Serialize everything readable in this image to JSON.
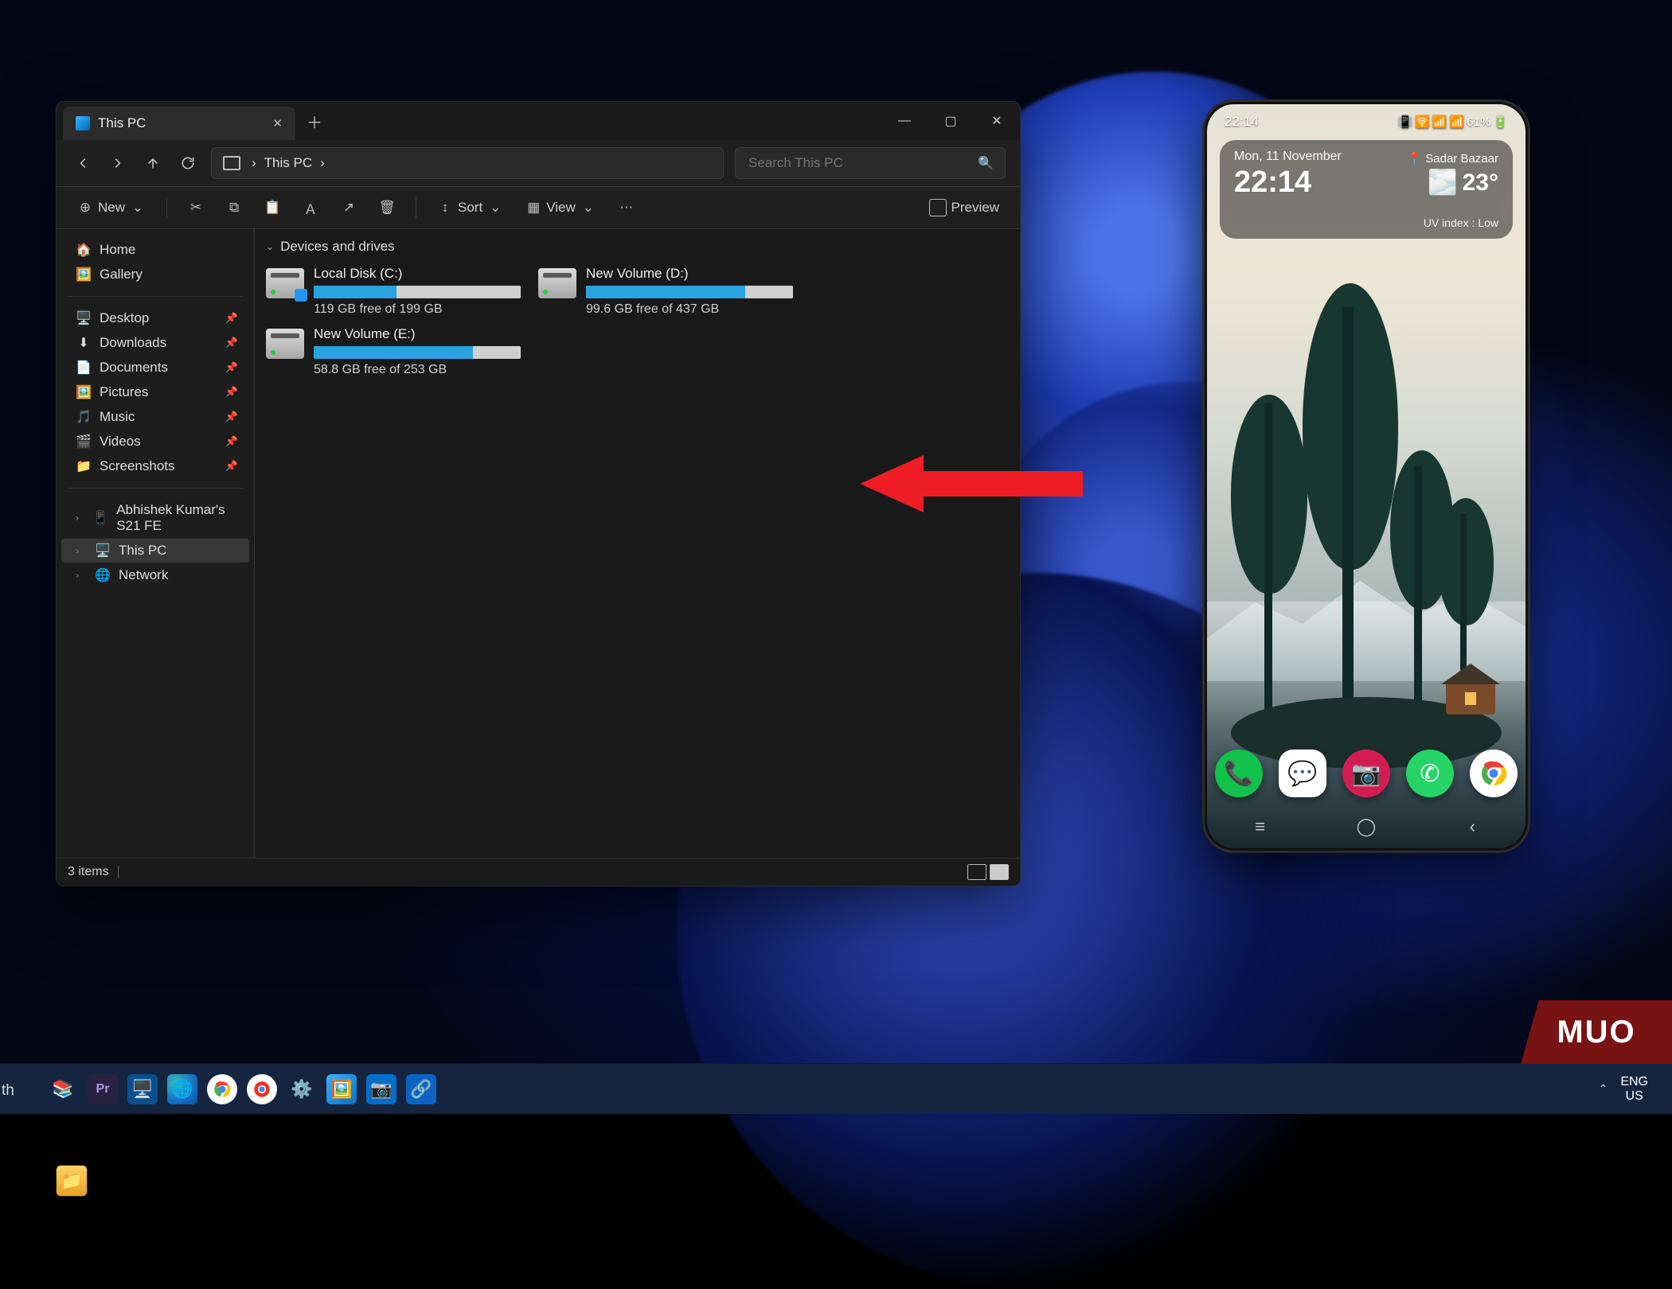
{
  "explorer": {
    "tab_title": "This PC",
    "crumb": "This PC",
    "search_placeholder": "Search This PC",
    "toolbar": {
      "new": "New",
      "sort": "Sort",
      "view": "View",
      "preview": "Preview"
    },
    "sidebar": {
      "home": "Home",
      "gallery": "Gallery",
      "pinned": [
        {
          "label": "Desktop",
          "icon": "🖥️"
        },
        {
          "label": "Downloads",
          "icon": "⬇"
        },
        {
          "label": "Documents",
          "icon": "📄"
        },
        {
          "label": "Pictures",
          "icon": "🖼️"
        },
        {
          "label": "Music",
          "icon": "🎵"
        },
        {
          "label": "Videos",
          "icon": "🎬"
        },
        {
          "label": "Screenshots",
          "icon": "📁"
        }
      ],
      "device_phone": "Abhishek Kumar's S21 FE",
      "this_pc": "This PC",
      "network": "Network"
    },
    "group_header": "Devices and drives",
    "drives": [
      {
        "name": "Local Disk (C:)",
        "free": "119 GB free of 199 GB",
        "used_pct": 40,
        "badge": true
      },
      {
        "name": "New Volume (D:)",
        "free": "99.6 GB free of 437 GB",
        "used_pct": 77,
        "badge": false
      },
      {
        "name": "New Volume (E:)",
        "free": "58.8 GB free of 253 GB",
        "used_pct": 77,
        "badge": false
      }
    ],
    "status": "3 items"
  },
  "phone": {
    "status_time": "22:14",
    "status_batt": "61%",
    "widget": {
      "date": "Mon, 11 November",
      "clock": "22:14",
      "location": "Sadar Bazaar",
      "temp": "23°",
      "uv": "UV index : Low"
    },
    "dock": [
      "phone-icon",
      "messages-icon",
      "camera-icon",
      "whatsapp-icon",
      "chrome-icon"
    ]
  },
  "taskbar": {
    "tray_lang_top": "ENG",
    "tray_lang_bottom": "US"
  },
  "thlabel": "th",
  "watermark": "MUO"
}
